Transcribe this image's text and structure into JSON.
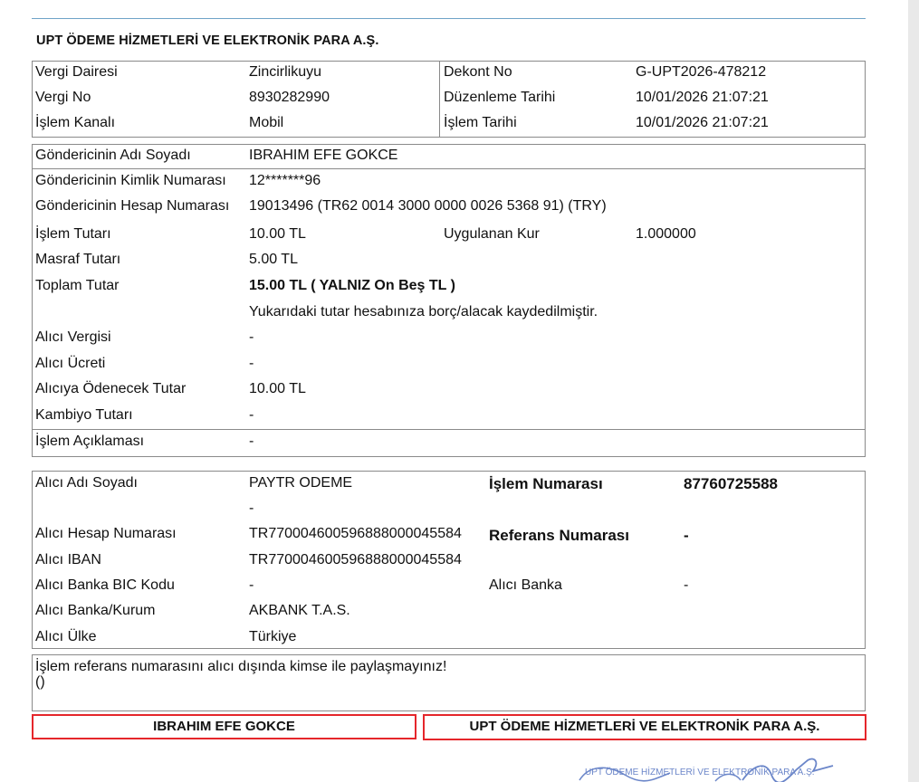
{
  "company": {
    "title": "UPT ÖDEME HİZMETLERİ VE ELEKTRONİK PARA A.Ş."
  },
  "header": {
    "vergi_dairesi_label": "Vergi Dairesi",
    "vergi_dairesi": "Zincirlikuyu",
    "vergi_no_label": "Vergi No",
    "vergi_no": "8930282990",
    "islem_kanali_label": "İşlem Kanalı",
    "islem_kanali": "Mobil",
    "dekont_no_label": "Dekont No",
    "dekont_no": "G-UPT2026-478212",
    "duzenleme_label": "Düzenleme Tarihi",
    "duzenleme": "10/01/2026 21:07:21",
    "islem_tarihi_label": "İşlem Tarihi",
    "islem_tarihi": "10/01/2026 21:07:21"
  },
  "sender": {
    "ad_label": "Göndericinin Adı Soyadı",
    "ad": "IBRAHIM EFE GOKCE",
    "kimlik_label": "Göndericinin Kimlik Numarası",
    "kimlik": "12*******96",
    "hesap_label": "Göndericinin Hesap Numarası",
    "hesap": "19013496 (TR62 0014 3000 0000 0026 5368 91) (TRY)",
    "tutar_label": "İşlem Tutarı",
    "tutar": "10.00 TL",
    "kur_label": "Uygulanan Kur",
    "kur": "1.000000",
    "masraf_label": "Masraf Tutarı",
    "masraf": "5.00 TL",
    "toplam_label": "Toplam Tutar",
    "toplam": "15.00 TL  ( YALNIZ On Beş TL  )",
    "note": "Yukarıdaki tutar hesabınıza borç/alacak kaydedilmiştir.",
    "alici_vergisi_label": "Alıcı Vergisi",
    "alici_vergisi": "-",
    "alici_ucreti_label": "Alıcı Ücreti",
    "alici_ucreti": "-",
    "odenecek_label": "Alıcıya Ödenecek Tutar",
    "odenecek": "10.00 TL",
    "kambiyo_label": "Kambiyo Tutarı",
    "kambiyo": "-",
    "aciklama_label": "İşlem Açıklaması",
    "aciklama": "-"
  },
  "receiver": {
    "ad_label": "Alıcı Adı Soyadı",
    "ad": "PAYTR  ODEME",
    "ad_line2": "-",
    "islem_no_label": "İşlem Numarası",
    "islem_no": "87760725588",
    "hesap_label": "Alıcı Hesap Numarası",
    "hesap": "TR770004600596888000045584",
    "referans_label": "Referans Numarası",
    "referans": "-",
    "iban_label": "Alıcı IBAN",
    "iban": "TR770004600596888000045584",
    "bic_label": "Alıcı Banka BIC Kodu",
    "bic": "-",
    "banka_label": "Alıcı Banka",
    "banka": "-",
    "kurum_label": "Alıcı Banka/Kurum",
    "kurum": "AKBANK T.A.S.",
    "ulke_label": "Alıcı Ülke",
    "ulke": "Türkiye"
  },
  "warning": {
    "line1": "İşlem referans numarasını alıcı dışında kimse ile paylaşmayınız!",
    "line2": "()"
  },
  "signatures": {
    "left": "IBRAHIM EFE GOKCE",
    "right": "UPT ÖDEME HİZMETLERİ VE ELEKTRONİK PARA A.Ş."
  },
  "stamp": {
    "text": "UPT ÖDEME HİZMETLERİ VE ELEKTRONİK PARA A.Ş.",
    "color": "#6b86c9"
  }
}
